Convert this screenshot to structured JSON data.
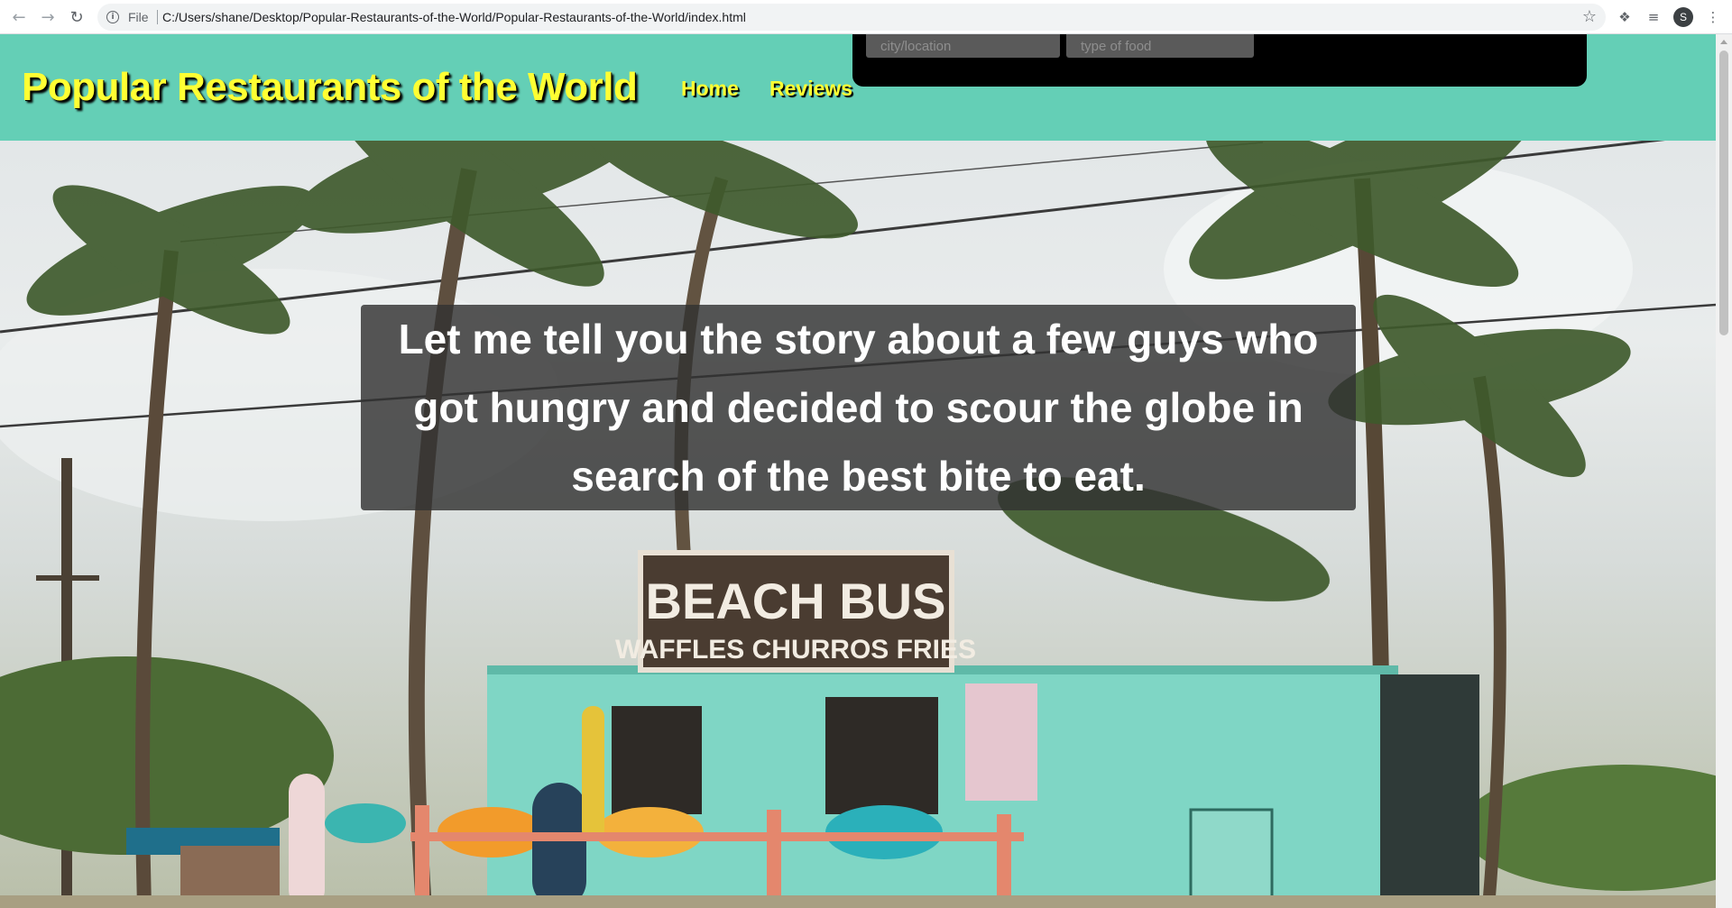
{
  "browser": {
    "scheme_label": "File",
    "url": "C:/Users/shane/Desktop/Popular-Restaurants-of-the-World/Popular-Restaurants-of-the-World/index.html",
    "profile_initial": "S",
    "icons": [
      "back-arrow-icon",
      "forward-arrow-icon",
      "reload-icon",
      "info-icon",
      "bookmark-star-icon",
      "extensions-puzzle-icon",
      "reading-list-icon",
      "kebab-menu-icon"
    ]
  },
  "header": {
    "title": "Popular Restaurants of the World",
    "nav": {
      "home": "Home",
      "reviews": "Reviews"
    },
    "background_color": "#64cfb6",
    "title_color": "#ffff33"
  },
  "search": {
    "location_placeholder": "city/location",
    "food_placeholder": "type of food"
  },
  "hero": {
    "story": "Let me tell you the story about a few guys who got hungry and decided to scour the globe in search of the best bite to eat.",
    "sign_text": {
      "name": "BEACH BUS",
      "items": "WAFFLES  CHURROS  FRIES"
    }
  }
}
